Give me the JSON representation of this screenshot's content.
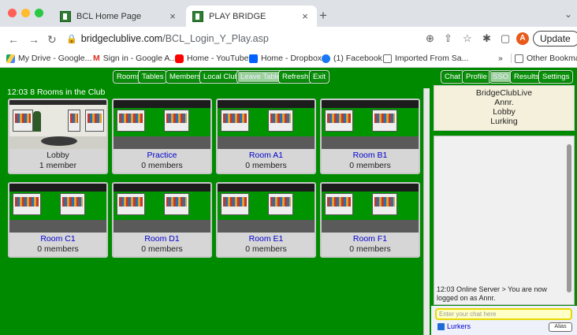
{
  "browser": {
    "tabs": [
      {
        "title": "BCL Home Page",
        "close": "×"
      },
      {
        "title": "PLAY BRIDGE",
        "close": "×"
      }
    ],
    "new_tab": "+",
    "tab_menu": "⌄",
    "url_host": "bridgeclublive.com",
    "url_path": "/BCL_Login_Y_Play.asp",
    "profile_initial": "A",
    "update_label": "Update",
    "bookmarks": [
      "My Drive - Google...",
      "Sign in - Google A...",
      "Home - YouTube",
      "Home - Dropbox",
      "(1) Facebook",
      "Imported From Sa..."
    ],
    "bookmarks_overflow": "»",
    "other_bookmarks": "Other Bookmarks"
  },
  "toolbar_left": [
    "Rooms",
    "Tables",
    "Members",
    "Local Club",
    "Leave Table",
    "Refresh",
    "Exit"
  ],
  "toolbar_right": [
    "Chat",
    "Profile",
    "SSO",
    "Results",
    "Settings"
  ],
  "rooms_header": "12:03 8 Rooms in the Club",
  "rooms": [
    {
      "name": "Lobby",
      "count": "1 member"
    },
    {
      "name": "Practice",
      "count": "0 members"
    },
    {
      "name": "Room A1",
      "count": "0 members"
    },
    {
      "name": "Room B1",
      "count": "0 members"
    },
    {
      "name": "Room C1",
      "count": "0 members"
    },
    {
      "name": "Room D1",
      "count": "0 members"
    },
    {
      "name": "Room E1",
      "count": "0 members"
    },
    {
      "name": "Room F1",
      "count": "0 members"
    }
  ],
  "info": {
    "club": "BridgeClubLive",
    "user": "Annr.",
    "location": "Lobby",
    "status": "Lurking"
  },
  "chat": {
    "message": "12:03 Online Server > You are now logged on as Annr.",
    "input_placeholder": "Enter your chat here",
    "lurkers_label": "Lurkers",
    "alias_label": "Alias"
  },
  "colors": {
    "app_green": "#008a00",
    "room_link": "#0000cc",
    "chat_input_bg": "#ffffc8"
  }
}
